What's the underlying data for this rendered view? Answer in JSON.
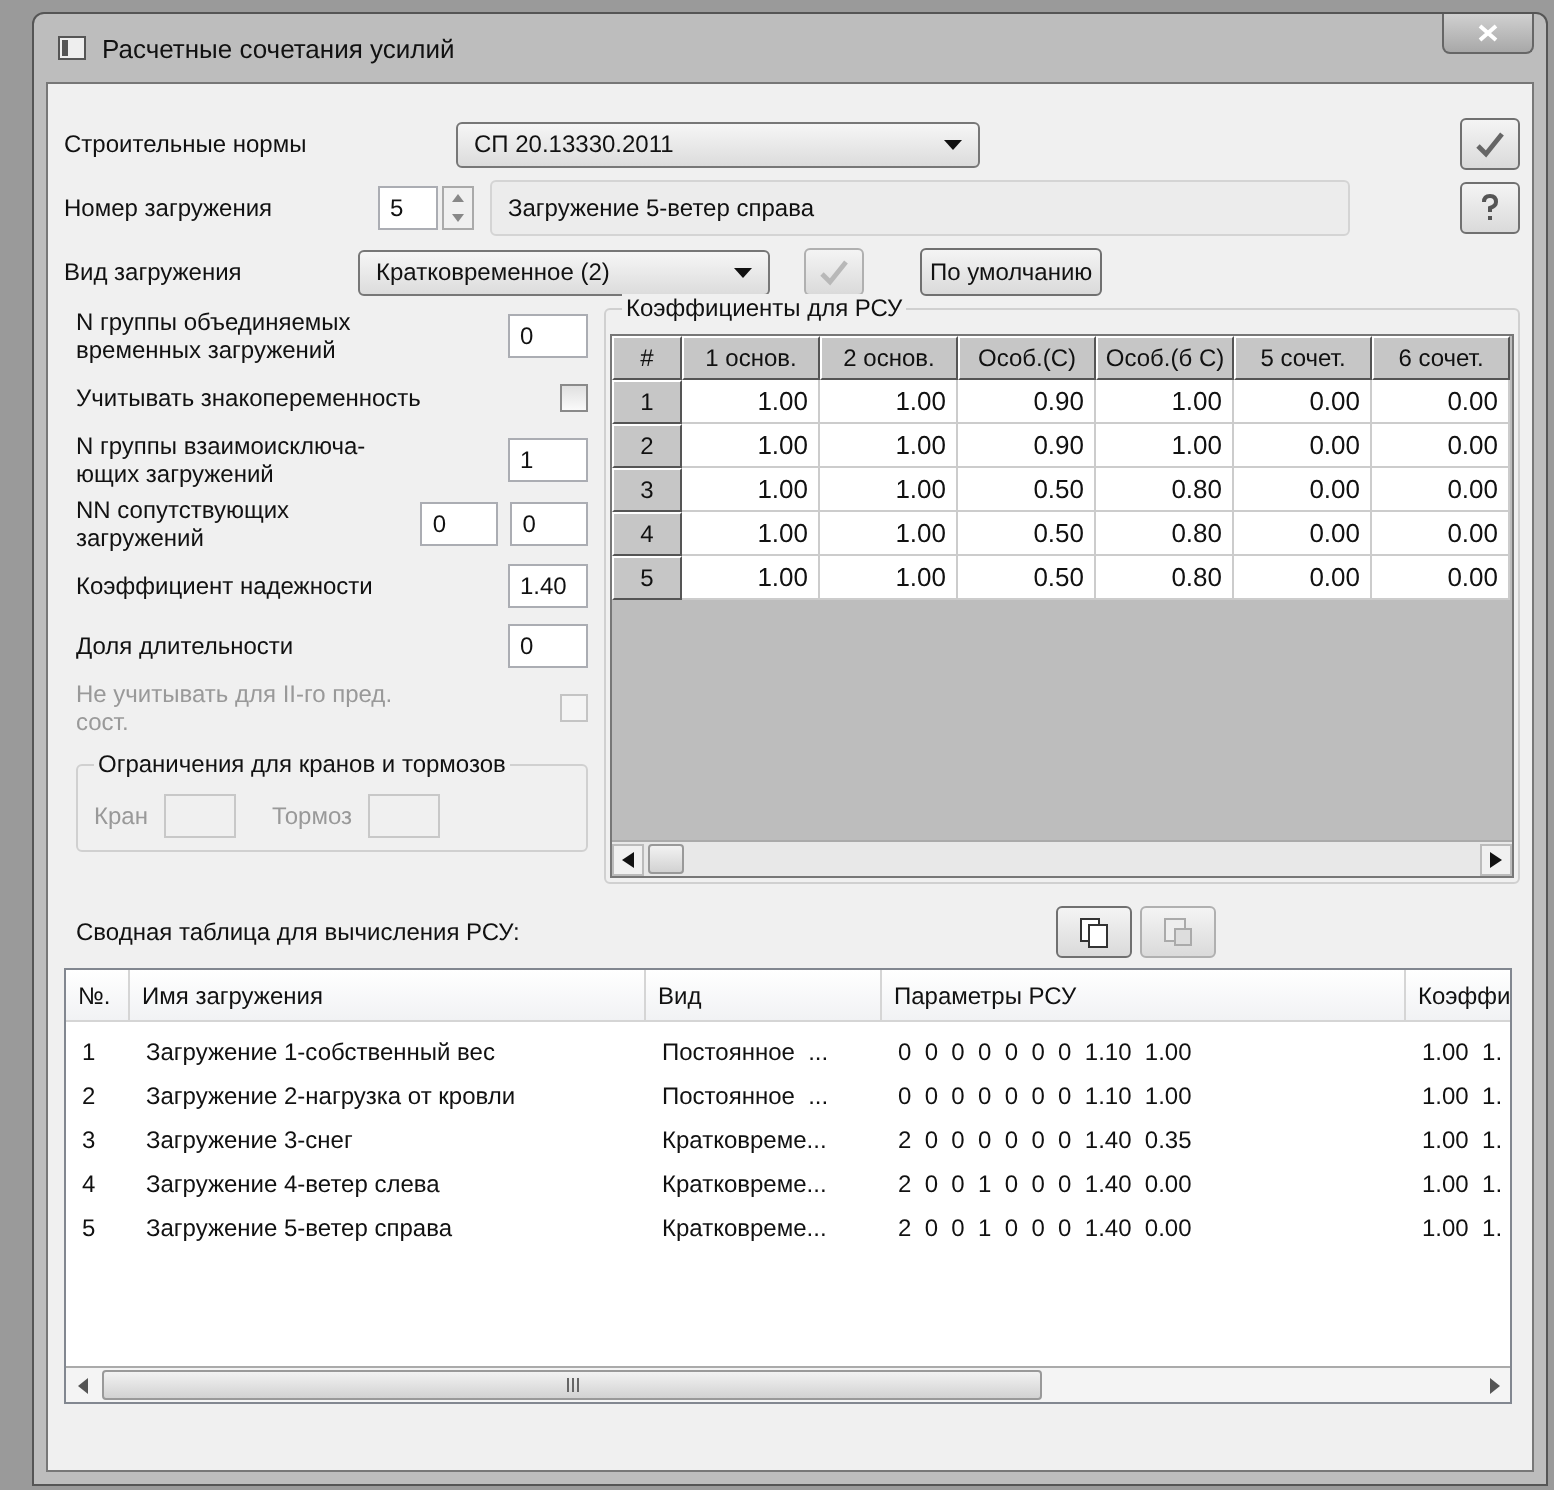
{
  "window": {
    "title": "Расчетные сочетания усилий"
  },
  "norms": {
    "label": "Строительные нормы",
    "value": "СП 20.13330.2011"
  },
  "load_number": {
    "label": "Номер загружения",
    "value": "5",
    "description": "Загружение 5-ветер справа"
  },
  "load_type": {
    "label": "Вид загружения",
    "value": "Кратковременное (2)",
    "apply_disabled": true,
    "default_button": "По умолчанию"
  },
  "params": [
    {
      "kind": "field",
      "label": "N группы объединяемых временных загружений",
      "values": [
        "0"
      ]
    },
    {
      "kind": "checkbox",
      "label": "Учитывать знакопеременность",
      "checked": false,
      "disabled": false
    },
    {
      "kind": "field",
      "label": "N группы взаимоисключа-ющих загружений",
      "values": [
        "1"
      ]
    },
    {
      "kind": "field",
      "label": "NN сопутствующих загружений",
      "values": [
        "0",
        "0"
      ]
    },
    {
      "kind": "field",
      "label": "Коэффициент надежности",
      "values": [
        "1.40"
      ]
    },
    {
      "kind": "field",
      "label": "Доля длительности",
      "values": [
        "0"
      ]
    },
    {
      "kind": "checkbox",
      "label": "Не учитывать для II-го пред. сост.",
      "checked": false,
      "disabled": true
    }
  ],
  "limits": {
    "title": "Ограничения для кранов и тормозов",
    "disabled": true,
    "fields": [
      "Кран",
      "Тормоз"
    ]
  },
  "coefficients": {
    "title": "Коэффициенты для РСУ",
    "columns": [
      "#",
      "1 основ.",
      "2 основ.",
      "Особ.(С)",
      "Особ.(б С)",
      "5 сочет.",
      "6 сочет."
    ],
    "rows": [
      [
        "1",
        "1.00",
        "1.00",
        "0.90",
        "1.00",
        "0.00",
        "0.00"
      ],
      [
        "2",
        "1.00",
        "1.00",
        "0.90",
        "1.00",
        "0.00",
        "0.00"
      ],
      [
        "3",
        "1.00",
        "1.00",
        "0.50",
        "0.80",
        "0.00",
        "0.00"
      ],
      [
        "4",
        "1.00",
        "1.00",
        "0.50",
        "0.80",
        "0.00",
        "0.00"
      ],
      [
        "5",
        "1.00",
        "1.00",
        "0.50",
        "0.80",
        "0.00",
        "0.00"
      ]
    ]
  },
  "summary": {
    "title": "Сводная таблица для вычисления РСУ:",
    "copy_disabled": false,
    "paste_disabled": true,
    "columns": [
      "№.",
      "Имя загружения",
      "Вид",
      "Параметры РСУ",
      "Коэффи"
    ],
    "rows": [
      [
        "1",
        "Загружение 1-собственный вес",
        "Постоянное  ...",
        "0  0  0  0  0  0  0  1.10  1.00",
        "1.00  1."
      ],
      [
        "2",
        "Загружение 2-нагрузка от кровли",
        "Постоянное  ...",
        "0  0  0  0  0  0  0  1.10  1.00",
        "1.00  1."
      ],
      [
        "3",
        "Загружение 3-снег",
        "Кратковреме...",
        "2  0  0  0  0  0  0  1.40  0.35",
        "1.00  1."
      ],
      [
        "4",
        "Загружение 4-ветер слева",
        "Кратковреме...",
        "2  0  0  1  0  0  0  1.40  0.00",
        "1.00  1."
      ],
      [
        "5",
        "Загружение 5-ветер справа",
        "Кратковреме...",
        "2  0  0  1  0  0  0  1.40  0.00",
        "1.00  1."
      ]
    ]
  }
}
